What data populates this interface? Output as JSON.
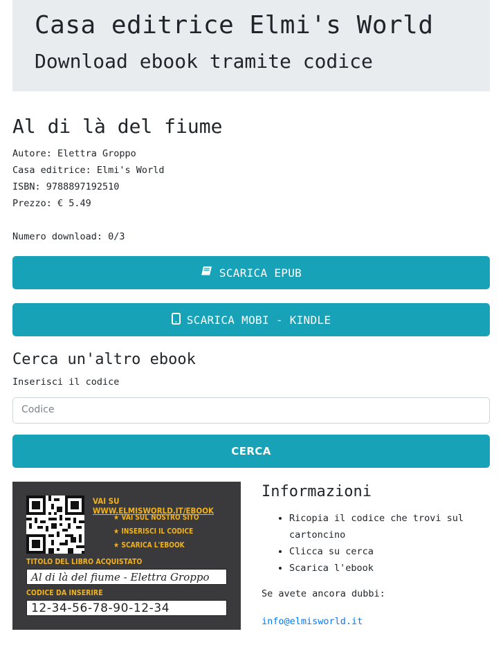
{
  "header": {
    "title": "Casa editrice Elmi's World",
    "subtitle": "Download ebook tramite codice"
  },
  "book": {
    "title": "Al di là del fiume",
    "author": "Autore: Elettra Groppo",
    "publisher": "Casa editrice: Elmi's World",
    "isbn": "ISBN: 9788897192510",
    "price": "Prezzo: € 5.49",
    "downloads": "Numero download: 0/3"
  },
  "buttons": {
    "epub": "SCARICA EPUB",
    "mobi": "SCARICA MOBI - KINDLE"
  },
  "search": {
    "heading": "Cerca un'altro ebook",
    "label": "Inserisci il codice",
    "placeholder": "Codice",
    "value": "",
    "button": "CERCA"
  },
  "card": {
    "visit_prefix": "VAI SU ",
    "visit_url": "WWW.ELMISWORLD.IT/EBOOK",
    "steps": [
      "VAI SUL NOSTRO SITO",
      "INSERISCI IL CODICE",
      "SCARICA L'EBOOK"
    ],
    "title_label": "TITOLO DEL LIBRO ACQUISTATO",
    "title_value": "Al di là del fiume - Elettra Groppo",
    "code_label": "CODICE DA INSERIRE",
    "code_value": "12-34-56-78-90-12-34",
    "accent_color": "#f2b21d",
    "background_color": "#3a3a3c"
  },
  "info": {
    "heading": "Informazioni",
    "items": [
      "Ricopia il codice che trovi sul cartoncino",
      "Clicca su cerca",
      "Scarica l'ebook"
    ],
    "doubts": "Se avete ancora dubbi:",
    "email": "info@elmisworld.it"
  },
  "colors": {
    "button": "#17a2b8",
    "jumbotron": "#e9ecef",
    "link": "#007bff"
  },
  "icons": {
    "epub": "book-icon",
    "mobi": "tablet-icon",
    "step": "star-icon"
  }
}
